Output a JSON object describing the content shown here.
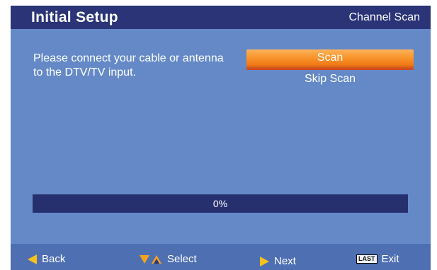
{
  "header": {
    "title": "Initial Setup",
    "breadcrumb": "Channel Scan"
  },
  "instruction": "Please connect your cable or antenna to the DTV/TV input.",
  "menu": {
    "items": [
      {
        "label": "Scan",
        "selected": true
      },
      {
        "label": "Skip Scan",
        "selected": false
      }
    ]
  },
  "progress": {
    "value": 0,
    "label": "0%"
  },
  "footer": {
    "back": {
      "label": "Back",
      "icon": "left-arrow-icon"
    },
    "select": {
      "label": "Select",
      "icon": "up-down-arrows-icon"
    },
    "next": {
      "label": "Next",
      "icon": "right-arrow-icon"
    },
    "exit": {
      "label": "Exit",
      "key": "LAST"
    }
  },
  "colors": {
    "header_bg": "#2a3476",
    "screen_bg": "#6589c7",
    "highlight": "#f8932a",
    "progress_bg": "#26306f",
    "footer_bg": "#4f6fb3"
  }
}
